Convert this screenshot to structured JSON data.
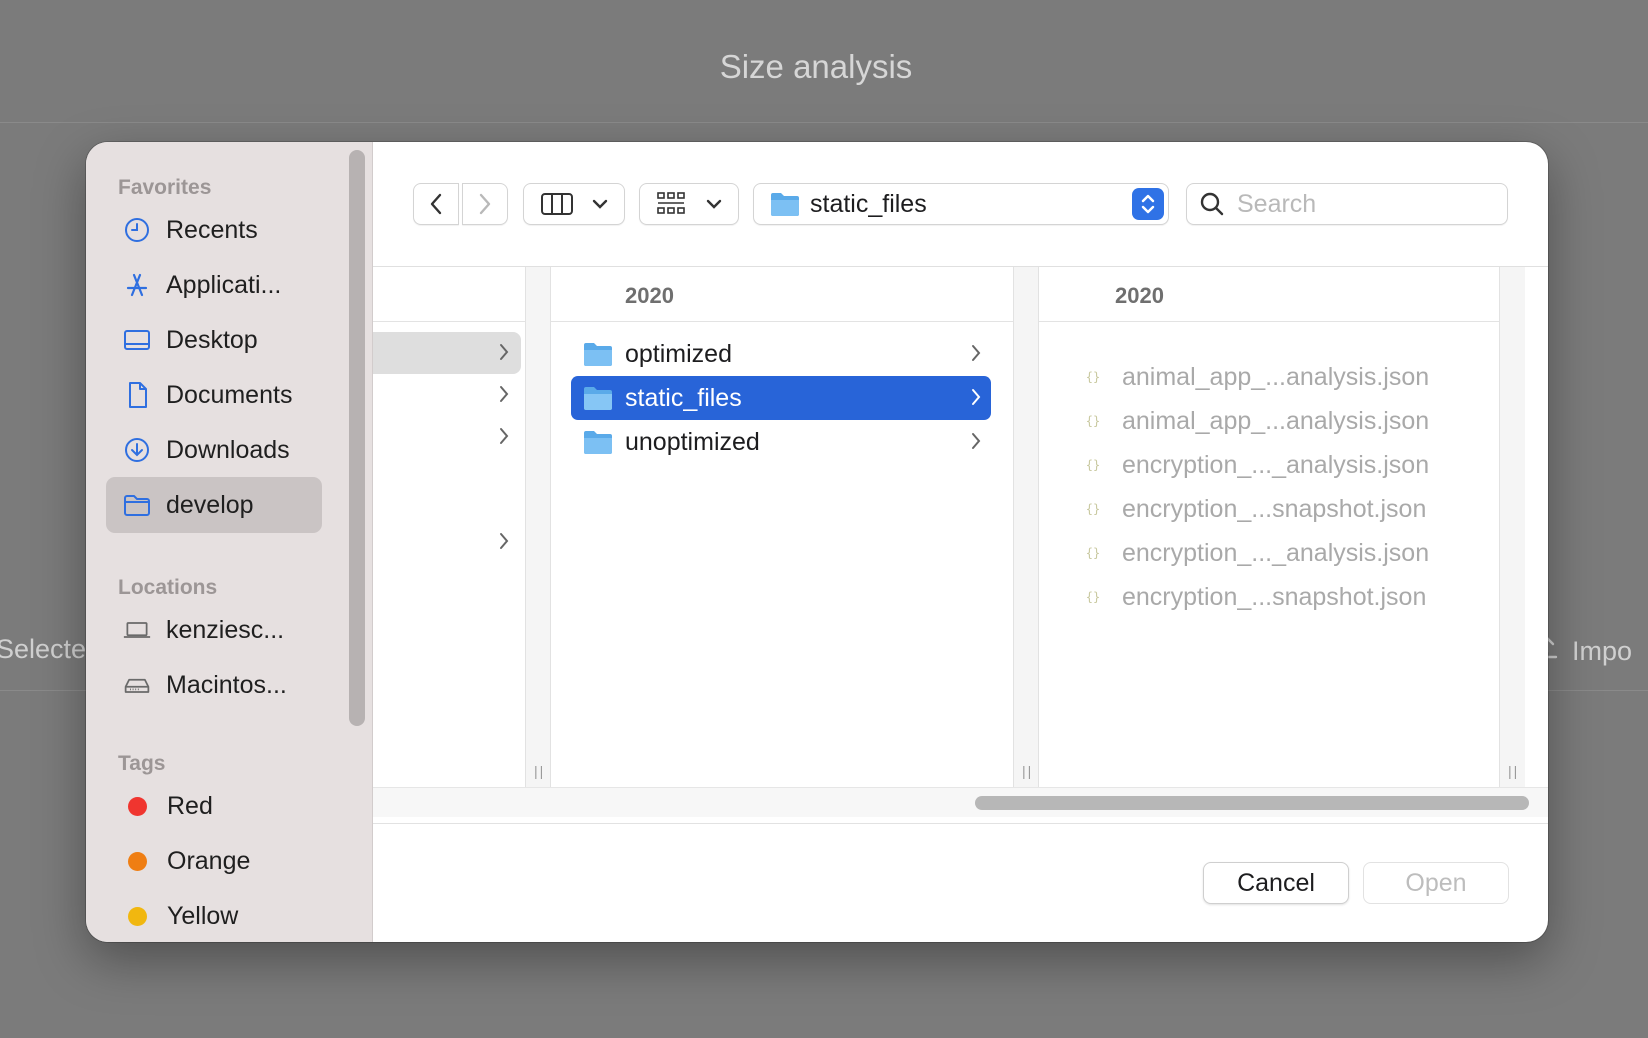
{
  "app": {
    "title": "Size analysis",
    "selected_label": "Selecte",
    "import_label": "Impo"
  },
  "sidebar": {
    "sections": {
      "favorites": "Favorites",
      "locations": "Locations",
      "tags": "Tags"
    },
    "favorites": [
      {
        "label": "Recents",
        "icon": "clock-icon"
      },
      {
        "label": "Applicati...",
        "icon": "applications-icon"
      },
      {
        "label": "Desktop",
        "icon": "desktop-icon"
      },
      {
        "label": "Documents",
        "icon": "document-icon"
      },
      {
        "label": "Downloads",
        "icon": "download-icon"
      },
      {
        "label": "develop",
        "icon": "folder-icon",
        "active": true
      }
    ],
    "locations": [
      {
        "label": "kenziesc...",
        "icon": "laptop-icon"
      },
      {
        "label": "Macintos...",
        "icon": "disk-icon"
      }
    ],
    "tags": [
      {
        "label": "Red",
        "color": "#f0352f"
      },
      {
        "label": "Orange",
        "color": "#ef7e13"
      },
      {
        "label": "Yellow",
        "color": "#f1b70f"
      }
    ]
  },
  "toolbar": {
    "path_folder": "static_files",
    "search_placeholder": "Search"
  },
  "columns": {
    "col1_header": "2020",
    "col1_items": [
      "optimized",
      "static_files",
      "unoptimized"
    ],
    "col1_selected": "static_files",
    "col2_header": "2020",
    "col2_items": [
      "animal_app_...analysis.json",
      "animal_app_...analysis.json",
      "encryption_..._analysis.json",
      "encryption_...snapshot.json",
      "encryption_..._analysis.json",
      "encryption_...snapshot.json"
    ]
  },
  "buttons": {
    "cancel": "Cancel",
    "open": "Open"
  },
  "colors": {
    "accent": "#2864d8",
    "sidebar_icon": "#2f6fe0"
  }
}
